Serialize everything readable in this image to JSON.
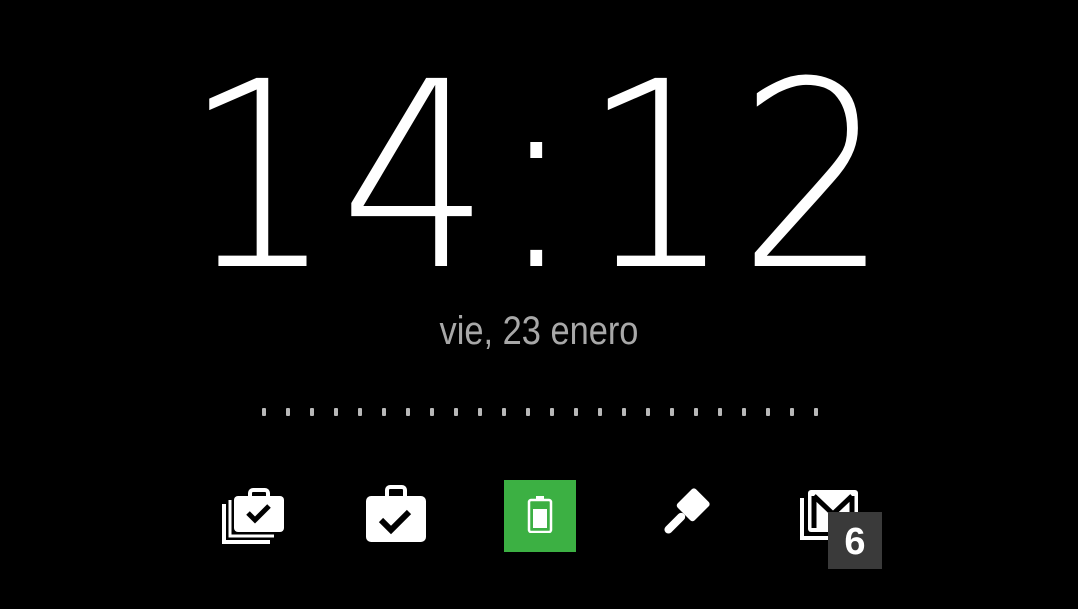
{
  "clock": {
    "time": "14:12"
  },
  "date": {
    "text": "vie, 23 enero"
  },
  "page_indicator": {
    "count": 24
  },
  "app_bar": {
    "items": [
      {
        "icon": "tasks-stack-icon"
      },
      {
        "icon": "briefcase-check-icon"
      },
      {
        "icon": "battery-icon",
        "background": "#3cb043"
      },
      {
        "icon": "paint-brush-icon"
      },
      {
        "icon": "gmail-icon",
        "badge": "6"
      }
    ]
  },
  "colors": {
    "background": "#000000",
    "clock": "#ffffff",
    "date": "#a8a8a8",
    "battery_tile": "#3cb043",
    "badge": "#3a3a3a"
  }
}
